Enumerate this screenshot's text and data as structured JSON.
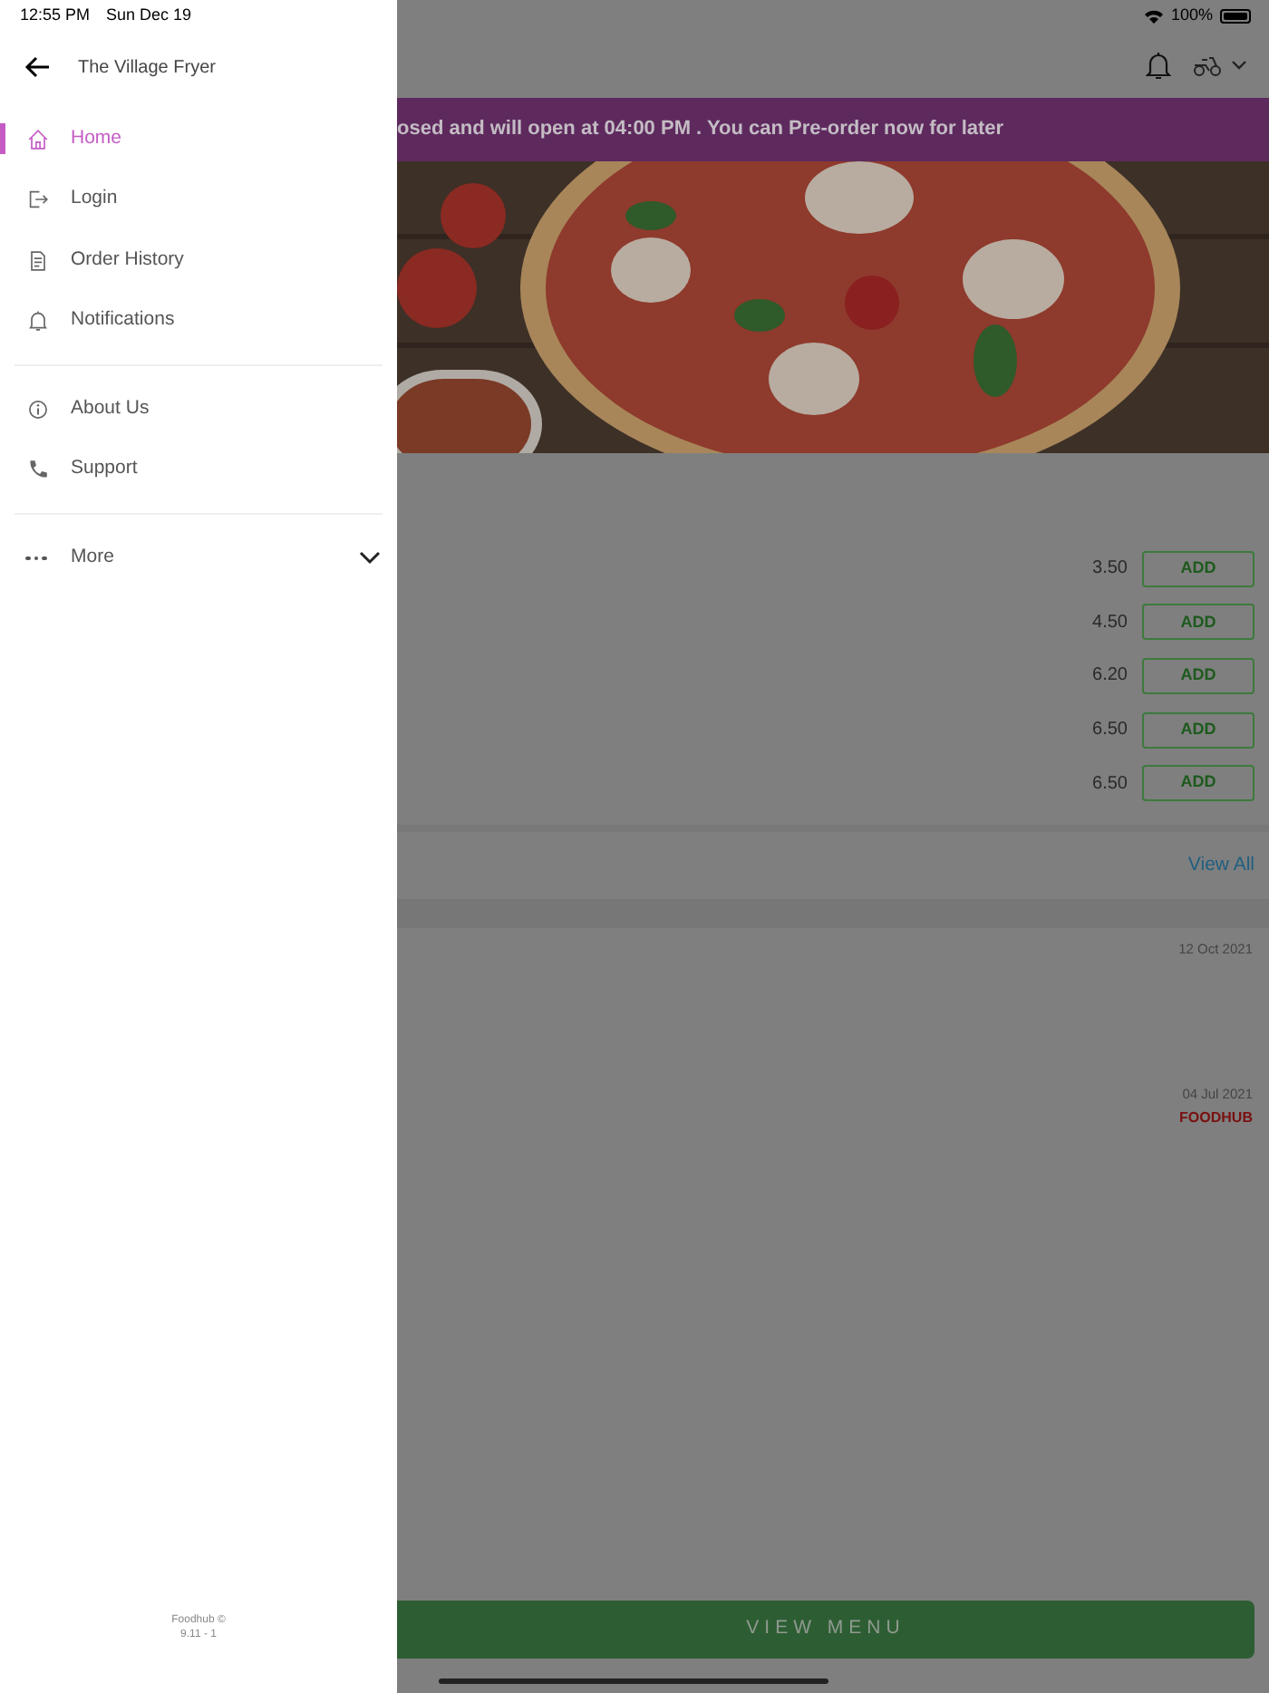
{
  "status_bar": {
    "time": "12:55 PM",
    "date": "Sun Dec 19",
    "battery": "100%"
  },
  "drawer": {
    "title": "The Village Fryer",
    "groups": [
      [
        {
          "label": "Home",
          "selected": true
        },
        {
          "label": "Login",
          "selected": false
        },
        {
          "label": "Order History",
          "selected": false
        },
        {
          "label": "Notifications",
          "selected": false
        }
      ],
      [
        {
          "label": "About Us",
          "selected": false
        },
        {
          "label": "Support",
          "selected": false
        }
      ]
    ],
    "more": {
      "label": "More"
    },
    "footer": [
      "Foodhub ©",
      "9.11 - 1"
    ]
  },
  "page": {
    "banner": "osed and will open at 04:00 PM . You can Pre-order now for later",
    "items": [
      {
        "price": "3.50",
        "button": "ADD"
      },
      {
        "price": "4.50",
        "button": "ADD"
      },
      {
        "price": "6.20",
        "button": "ADD"
      },
      {
        "price": "6.50",
        "button": "ADD"
      },
      {
        "price": "6.50",
        "button": "ADD"
      }
    ],
    "view_all": "View All",
    "reviews": [
      {
        "date": "12 Oct 2021"
      },
      {
        "date": "04 Jul 2021",
        "source": "FOODHUB"
      }
    ],
    "view_menu": "VIEW MENU"
  }
}
